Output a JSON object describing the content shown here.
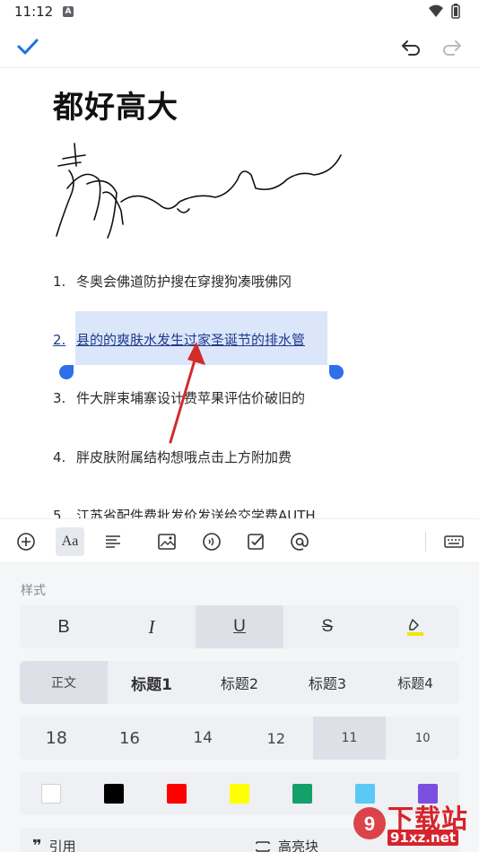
{
  "status_bar": {
    "time": "11:12",
    "notification_icon": "A"
  },
  "top_bar": {
    "done_icon": "check-icon",
    "undo_icon": "undo-icon",
    "redo_icon": "redo-icon"
  },
  "document": {
    "title": "都好高大",
    "sketch": "handwritten-signature",
    "list": [
      {
        "num": "1.",
        "text": "冬奥会佛道防护搜在穿搜狗凑哦佛冈"
      },
      {
        "num": "2.",
        "text": "县的的爽肤水发生过家圣诞节的排水管",
        "selected": true
      },
      {
        "num": "3.",
        "text": "件大胖束埔寨设计费苹果评估价破旧的"
      },
      {
        "num": "4.",
        "text": "胖皮肤附属结构想哦点击上方附加费"
      },
      {
        "num": "5.",
        "text": "江苏省配件费批发价发送给交学费AUTH"
      }
    ]
  },
  "toolbar": {
    "items": [
      "add-icon",
      "text-format-icon",
      "align-icon",
      "image-icon",
      "audio-icon",
      "checkbox-icon",
      "mention-icon",
      "keyboard-icon"
    ],
    "active": "text-format-icon",
    "text_format_label": "Aa"
  },
  "format_panel": {
    "section_label": "样式",
    "styles": [
      {
        "label": "B",
        "name": "bold"
      },
      {
        "label": "I",
        "name": "italic"
      },
      {
        "label": "U",
        "name": "underline",
        "active": true
      },
      {
        "label": "S",
        "name": "strikethrough"
      },
      {
        "label": "highlight-icon",
        "name": "highlight"
      }
    ],
    "headings": [
      {
        "label": "正文",
        "active": true
      },
      {
        "label": "标题1"
      },
      {
        "label": "标题2"
      },
      {
        "label": "标题3"
      },
      {
        "label": "标题4"
      }
    ],
    "sizes": [
      {
        "label": "18"
      },
      {
        "label": "16"
      },
      {
        "label": "14"
      },
      {
        "label": "12"
      },
      {
        "label": "11",
        "active": true
      },
      {
        "label": "10"
      }
    ],
    "colors": [
      "#ffffff",
      "#000000",
      "#ff0000",
      "#ffff00",
      "#15a06a",
      "#5bc8f5",
      "#7b4fe0"
    ],
    "blocks": [
      {
        "icon": "quote-icon",
        "label": "引用"
      },
      {
        "icon": "code-block-icon",
        "label": "高亮块"
      }
    ]
  },
  "watermark": {
    "text": "下载站",
    "url": "91xz.net"
  }
}
